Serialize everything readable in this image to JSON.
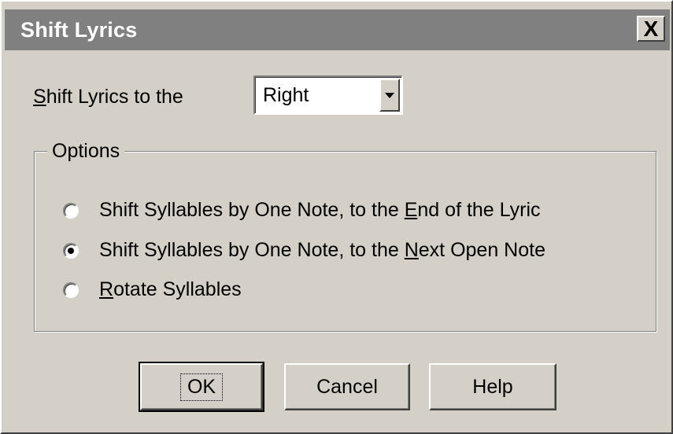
{
  "window": {
    "title": "Shift Lyrics",
    "close_symbol": "X"
  },
  "shift_label": {
    "underline": "S",
    "rest": "hift Lyrics to the"
  },
  "direction_select": {
    "value": "Right"
  },
  "options_group": {
    "legend": "Options",
    "radios": [
      {
        "before": "Shift Syllables by One Note, to the ",
        "underline": "E",
        "after": "nd of the Lyric"
      },
      {
        "before": "Shift Syllables by One Note, to the ",
        "underline": "N",
        "after": "ext Open Note"
      },
      {
        "before": "",
        "underline": "R",
        "after": "otate Syllables"
      }
    ],
    "selected_index": 1
  },
  "buttons": {
    "ok": "OK",
    "cancel": "Cancel",
    "help": "Help"
  }
}
